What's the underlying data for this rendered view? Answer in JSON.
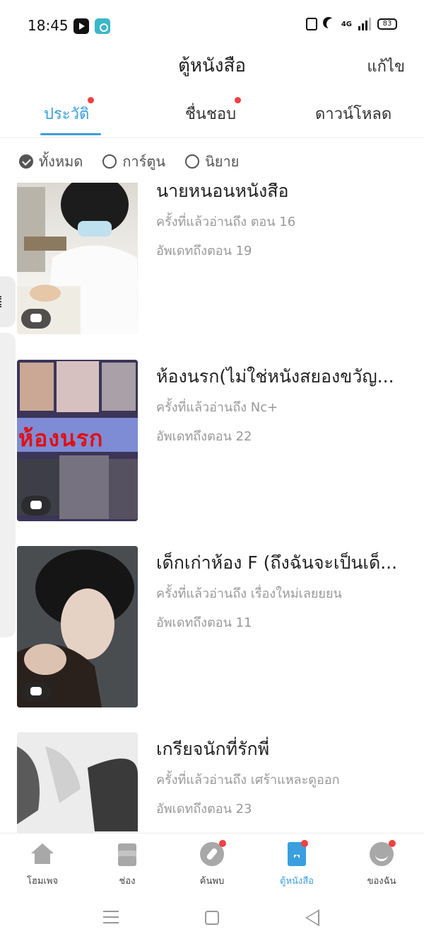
{
  "status_bar": {
    "time": "18:45",
    "battery": "83",
    "network": "4G"
  },
  "header": {
    "title": "ตู้หนังสือ",
    "edit_label": "แก้ไข"
  },
  "tabs": [
    {
      "label": "ประวัติ",
      "active": true,
      "has_dot": true
    },
    {
      "label": "ชื่นชอบ",
      "active": false,
      "has_dot": true
    },
    {
      "label": "ดาวน์โหลด",
      "active": false,
      "has_dot": false
    }
  ],
  "filters": [
    {
      "label": "ทั้งหมด",
      "checked": true
    },
    {
      "label": "การ์ตูน",
      "checked": false
    },
    {
      "label": "นิยาย",
      "checked": false
    }
  ],
  "books": [
    {
      "title": "นายหนอนหนังสือ",
      "last_read": "ครั้งที่แล้วอ่านถึง ตอน 16",
      "updated": "อัพเดทถึงตอน 19",
      "cover_icon": "comment-icon"
    },
    {
      "title": "ห้องนรก(ไม่ใช่หนังสยองขวัญ...",
      "last_read": "ครั้งที่แล้วอ่านถึง Nc+",
      "updated": "อัพเดทถึงตอน 22",
      "cover_text": "ห้องนรก",
      "cover_icon": "comment-icon"
    },
    {
      "title": "เด็กเก่าห้อง F (ถึงฉันจะเป็นเด็...",
      "last_read": "ครั้งที่แล้วอ่านถึง เรื่องใหม่เลยยยน",
      "updated": "อัพเดทถึงตอน 11",
      "cover_icon": "comment-icon"
    },
    {
      "title": "เกรียจนักที่รักพี่",
      "last_read": "ครั้งที่แล้วอ่านถึง เศร้าแหละดูออก",
      "updated": "อัพเดทถึงตอน 23",
      "cover_icon": "comment-icon"
    }
  ],
  "bottom_nav": [
    {
      "label": "โฮมเพจ",
      "icon": "home-icon",
      "active": false
    },
    {
      "label": "ช่อง",
      "icon": "layers-icon",
      "active": false
    },
    {
      "label": "ค้นพบ",
      "icon": "compass-icon",
      "active": false,
      "has_dot": true
    },
    {
      "label": "ตู้หนังสือ",
      "icon": "bookshelf-icon",
      "active": true,
      "has_dot": true
    },
    {
      "label": "ของฉัน",
      "icon": "profile-icon",
      "active": false,
      "has_dot": true
    }
  ],
  "colors": {
    "accent": "#3a9fde",
    "dot": "#f04040",
    "muted_text": "#999999"
  }
}
